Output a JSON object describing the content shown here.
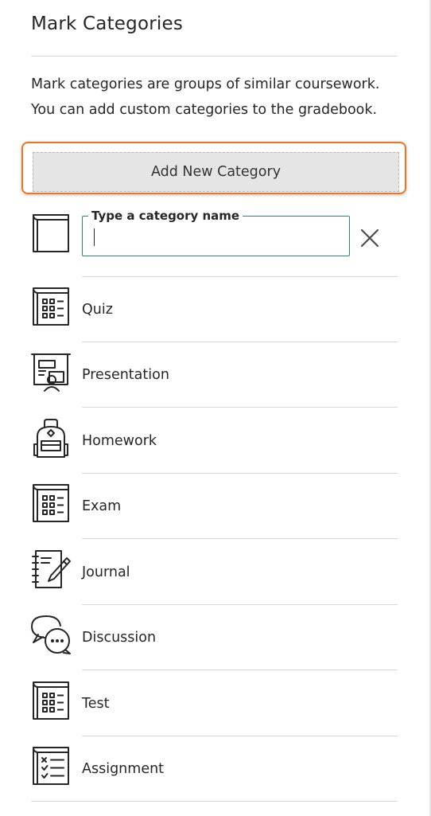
{
  "panel": {
    "title": "Mark Categories",
    "description_line1": "Mark categories are groups of similar coursework.",
    "description_line2": "You can add custom categories to the gradebook.",
    "add_button_label": "Add New Category"
  },
  "new_category": {
    "legend": "Type a category name",
    "value": "",
    "icon": "blank-page-icon",
    "close_icon": "close-icon"
  },
  "categories": [
    {
      "label": "Quiz",
      "icon": "calculator-sheet-icon"
    },
    {
      "label": "Presentation",
      "icon": "presentation-board-icon"
    },
    {
      "label": "Homework",
      "icon": "backpack-icon"
    },
    {
      "label": "Exam",
      "icon": "calculator-sheet-icon"
    },
    {
      "label": "Journal",
      "icon": "notebook-pencil-icon"
    },
    {
      "label": "Discussion",
      "icon": "speech-bubbles-icon"
    },
    {
      "label": "Test",
      "icon": "calculator-sheet-icon"
    },
    {
      "label": "Assignment",
      "icon": "checklist-icon"
    }
  ],
  "colors": {
    "focus_ring": "#e87722",
    "input_border": "#2a7fa8",
    "button_bg": "#e5e5e5",
    "text": "#262626",
    "divider": "#d6d6d6"
  }
}
